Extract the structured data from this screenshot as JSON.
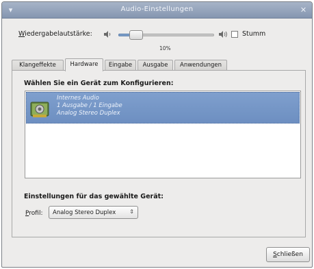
{
  "window": {
    "title": "Audio-Einstellungen"
  },
  "volume": {
    "label_mnemonic": "W",
    "label_rest": "iedergabelautstärke:",
    "level_percent": 10,
    "percent_text": "10%",
    "mute_label": "Stumm",
    "muted": false
  },
  "tabs": [
    {
      "label": "Klangeffekte",
      "active": false
    },
    {
      "label": "Hardware",
      "active": true
    },
    {
      "label": "Eingabe",
      "active": false
    },
    {
      "label": "Ausgabe",
      "active": false
    },
    {
      "label": "Anwendungen",
      "active": false
    }
  ],
  "hardware": {
    "choose_device_heading": "Wählen Sie ein Gerät zum Konfigurieren:",
    "devices": [
      {
        "name": "Internes Audio",
        "io": "1 Ausgabe / 1 Eingabe",
        "profile": "Analog Stereo Duplex",
        "icon": "sound-card-icon",
        "selected": true
      }
    ],
    "settings_heading": "Einstellungen für das gewählte Gerät:",
    "profile_label_mnemonic": "P",
    "profile_label_rest": "rofil:",
    "profile_value": "Analog Stereo Duplex"
  },
  "footer": {
    "close_mnemonic": "S",
    "close_rest": "chließen"
  },
  "colors": {
    "titlebar": "#8c9cb6",
    "selection": "#7596c6",
    "window_bg": "#edeceb"
  }
}
